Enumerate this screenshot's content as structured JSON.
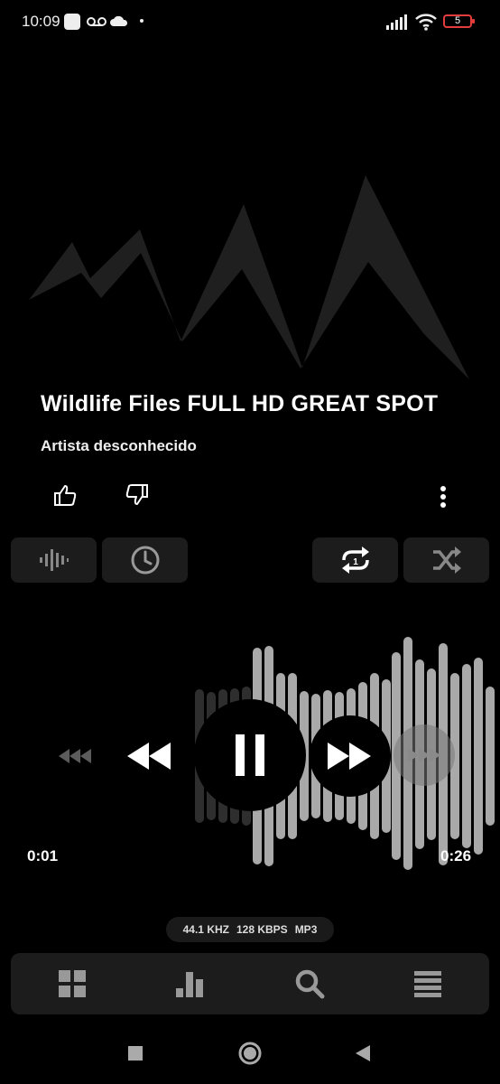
{
  "status_bar": {
    "time": "10:09",
    "battery": "5",
    "icons": [
      "square-notification-icon",
      "voicemail-icon",
      "cloud-icon",
      "dot-icon",
      "signal-icon",
      "wifi-icon",
      "battery-icon"
    ]
  },
  "track": {
    "title": "Wildlife Files FULL HD GREAT SPOT",
    "artist": "Artista desconhecido"
  },
  "player": {
    "current_time": "0:01",
    "total_time": "0:26",
    "is_playing": true
  },
  "audio_info": {
    "sample_rate": "44.1 KHZ",
    "bitrate": "128 KBPS",
    "format": "MP3"
  },
  "colors": {
    "background": "#000000",
    "panel": "#1c1c1c",
    "accent_red": "#e23c3c",
    "waveform_light": "#a8a8a8",
    "waveform_dim": "#3a3a3a"
  },
  "bottom_nav": {
    "items": [
      "grid-icon",
      "chart-icon",
      "search-icon",
      "menu-icon"
    ]
  }
}
